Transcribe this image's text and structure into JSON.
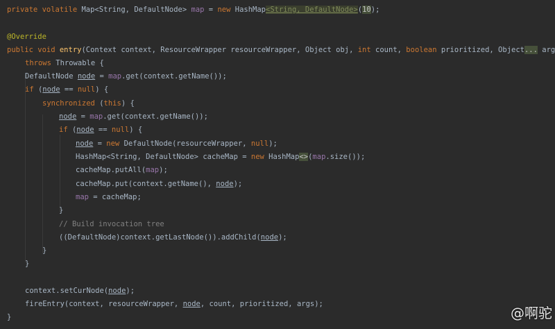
{
  "code": {
    "l1": {
      "kw": "private volatile ",
      "t1": "Map<String, DefaultNode> ",
      "field": "map",
      "t2": " = ",
      "kw2": "new ",
      "t3": "HashMap",
      "hint": "<String, DefaultNode>",
      "t4": "(",
      "num": "10",
      "t5": ");"
    },
    "l2": {
      "ann": "@Override"
    },
    "l3": {
      "kw": "public void ",
      "fn": "entry",
      "t1": "(Context context, ResourceWrapper resourceWrapper, Object obj, ",
      "kw2": "int ",
      "t2": "count, ",
      "kw3": "boolean ",
      "t3": "prioritized, Object",
      "hint": "...",
      "t4": " args)"
    },
    "l4": {
      "kw": "throws ",
      "t1": "Throwable {"
    },
    "l5": {
      "t1": "DefaultNode ",
      "var": "node",
      "t2": " = ",
      "fld": "map",
      "t3": ".get(context.getName());"
    },
    "l6": {
      "kw": "if ",
      "t1": "(",
      "var": "node",
      "t2": " == ",
      "kw2": "null",
      "t3": ") {"
    },
    "l7": {
      "kw": "synchronized ",
      "t1": "(",
      "kw2": "this",
      "t2": ") {"
    },
    "l8": {
      "var": "node",
      "t1": " = ",
      "fld": "map",
      "t2": ".get(context.getName());"
    },
    "l9": {
      "kw": "if ",
      "t1": "(",
      "var": "node",
      "t2": " == ",
      "kw2": "null",
      "t3": ") {"
    },
    "l10": {
      "var": "node",
      "t1": " = ",
      "kw": "new ",
      "t2": "DefaultNode(resourceWrapper, ",
      "kw2": "null",
      "t3": ");"
    },
    "l11": {
      "t1": "HashMap<String, DefaultNode> cacheMap = ",
      "kw": "new ",
      "t2": "HashMap",
      "hint": "<>",
      "t3": "(",
      "fld": "map",
      "t4": ".size());"
    },
    "l12": {
      "t1": "cacheMap.putAll(",
      "fld": "map",
      "t2": ");"
    },
    "l13": {
      "t1": "cacheMap.put(context.getName(), ",
      "var": "node",
      "t2": ");"
    },
    "l14": {
      "fld": "map",
      "t1": " = cacheMap;"
    },
    "l15": {
      "t1": "}"
    },
    "l16": {
      "cmt": "// Build invocation tree"
    },
    "l17": {
      "t1": "((DefaultNode)context.getLastNode()).addChild(",
      "var": "node",
      "t2": ");"
    },
    "l18": {
      "t1": "}"
    },
    "l19": {
      "t1": "}"
    },
    "l20": {
      "t1": "context.setCurNode(",
      "var": "node",
      "t2": ");"
    },
    "l21": {
      "t1": "fireEntry(context, resourceWrapper, ",
      "var": "node",
      "t2": ", count, prioritized, args);"
    },
    "l22": {
      "t1": "}"
    }
  },
  "watermark": "@啊驼"
}
